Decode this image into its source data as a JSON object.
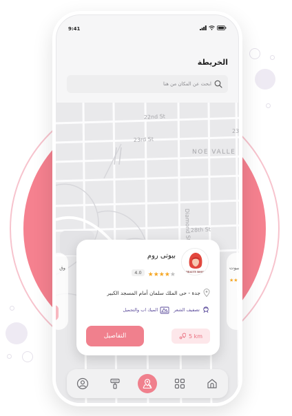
{
  "status_bar": {
    "time": "9:41"
  },
  "header": {
    "title": "الخريطة"
  },
  "search": {
    "placeholder": "ابحث عن المكان من هنا"
  },
  "map": {
    "streets": [
      "22nd St",
      "23rd St",
      "NOE VALLE",
      "Diamond St",
      "28th St",
      "23"
    ]
  },
  "card": {
    "name": "بيوتى روم",
    "rating": "4.0",
    "stars_filled": 4,
    "stars_total": 5,
    "logo_text": "BEAUTY ROOM",
    "address": "جدة - حى الملك سلمان أمام المسجد الكبير",
    "services": [
      "تصفيف الشعر",
      "الميك اب والتجميل"
    ],
    "details_label": "التفاصيل",
    "distance": "5 km"
  },
  "side_cards": {
    "right_name": "بيوت",
    "left_name": "وق"
  },
  "nav": {
    "items": [
      "home-icon",
      "grid-icon",
      "map-pin-icon",
      "brush-icon",
      "user-icon"
    ],
    "active": "map-pin-icon"
  },
  "colors": {
    "accent": "#f0808d",
    "accent_light": "#fde7ea",
    "star": "#f5a623",
    "service": "#5a4a9a"
  }
}
